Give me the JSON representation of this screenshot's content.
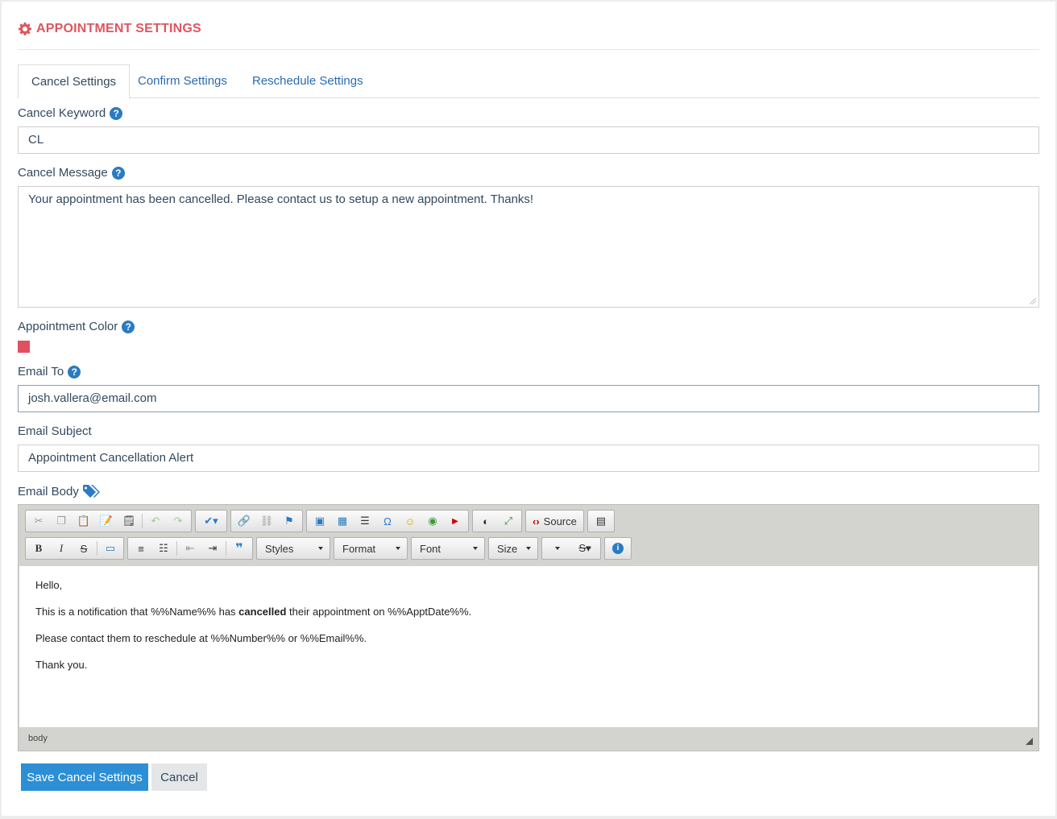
{
  "header": {
    "title": "APPOINTMENT SETTINGS",
    "icon": "gear-icon",
    "color": "#e0555f"
  },
  "tabs": [
    {
      "label": "Cancel Settings",
      "active": true
    },
    {
      "label": "Confirm Settings",
      "active": false
    },
    {
      "label": "Reschedule Settings",
      "active": false
    }
  ],
  "form": {
    "cancel_keyword": {
      "label": "Cancel Keyword",
      "value": "CL"
    },
    "cancel_message": {
      "label": "Cancel Message",
      "value": "Your appointment has been cancelled. Please contact us to setup a new appointment. Thanks!"
    },
    "appointment_color": {
      "label": "Appointment Color",
      "value": "#e05060"
    },
    "email_to": {
      "label": "Email To",
      "value": "josh.vallera@email.com"
    },
    "email_subject": {
      "label": "Email Subject",
      "value": "Appointment Cancellation Alert"
    },
    "email_body": {
      "label": "Email Body"
    }
  },
  "editor": {
    "source_label": "Source",
    "styles_label": "Styles",
    "format_label": "Format",
    "font_label": "Font",
    "size_label": "Size",
    "bold_label": "B",
    "italic_label": "I",
    "strike_label": "S",
    "content": {
      "line1": "Hello,",
      "line2_pre": "This is a notification that %%Name%% has ",
      "line2_bold": "cancelled",
      "line2_post": " their appointment on %%ApptDate%%.",
      "line3": "Please contact them to reschedule at %%Number%% or %%Email%%.",
      "line4": "Thank you."
    },
    "status_path": "body"
  },
  "actions": {
    "save_label": "Save Cancel Settings",
    "cancel_label": "Cancel"
  },
  "colors": {
    "primary": "#2c8fd6",
    "link": "#2a6bb0",
    "help": "#2a7bc1"
  }
}
